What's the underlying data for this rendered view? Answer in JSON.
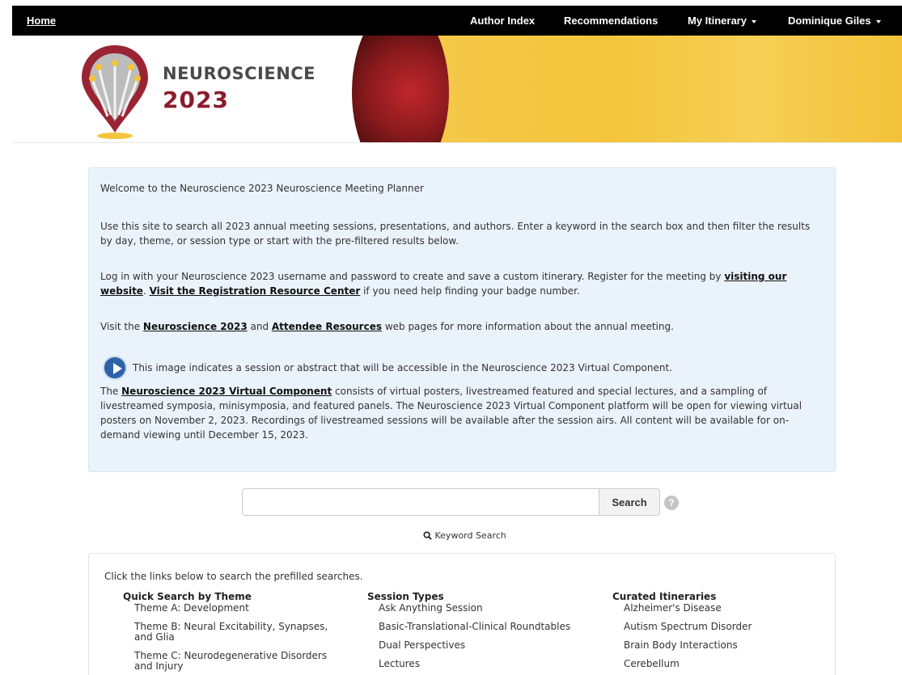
{
  "nav": {
    "home": "Home",
    "author_index": "Author Index",
    "recommendations": "Recommendations",
    "my_itinerary": "My Itinerary",
    "user_name": "Dominique Giles"
  },
  "banner": {
    "title": "NEUROSCIENCE",
    "year": "2023"
  },
  "welcome": {
    "heading": "Welcome to the Neuroscience 2023 Neuroscience Meeting Planner",
    "p1": "Use this site to search all 2023 annual meeting sessions, presentations, and authors. Enter a keyword in the search box and then filter the results by day, theme, or session type or start with the pre-filtered results below.",
    "p2_a": "Log in with your Neuroscience 2023 username and password to create and save a custom itinerary. Register for the meeting by ",
    "p2_link1": "visiting our website",
    "p2_b": ". ",
    "p2_link2": "Visit the Registration Resource Center",
    "p2_c": " if you need help finding your badge number.",
    "p3_a": "Visit the ",
    "p3_link1": "Neuroscience 2023",
    "p3_b": " and ",
    "p3_link2": "Attendee Resources",
    "p3_c": " web pages for more information about the annual meeting.",
    "icon_note": "This image indicates a session or abstract that will be accessible in the Neuroscience 2023 Virtual Component.",
    "p4_a": "The ",
    "p4_link": "Neuroscience 2023 Virtual Component",
    "p4_b": " consists of virtual posters, livestreamed featured and special lectures, and a sampling of livestreamed symposia, minisymposia, and featured panels. The Neuroscience 2023 Virtual Component platform will be open for viewing virtual posters on November 2, 2023. Recordings of livestreamed sessions will be available after the session airs. All content will be available for on-demand viewing until December 15, 2023."
  },
  "search": {
    "button": "Search",
    "help": "?",
    "keyword_link": "Keyword Search"
  },
  "prefill": {
    "intro": "Click the links below to search the prefilled searches.",
    "columns": [
      {
        "title": "Quick Search by Theme",
        "items": [
          "Theme A: Development",
          "Theme B: Neural Excitability, Synapses, and Glia",
          "Theme C: Neurodegenerative Disorders and Injury"
        ]
      },
      {
        "title": "Session Types",
        "items": [
          "Ask Anything Session",
          "Basic-Translational-Clinical Roundtables",
          "Dual Perspectives",
          "Lectures"
        ]
      },
      {
        "title": "Curated Itineraries",
        "items": [
          "Alzheimer's Disease",
          "Autism Spectrum Disorder",
          "Brain Body Interactions",
          "Cerebellum"
        ]
      }
    ]
  }
}
